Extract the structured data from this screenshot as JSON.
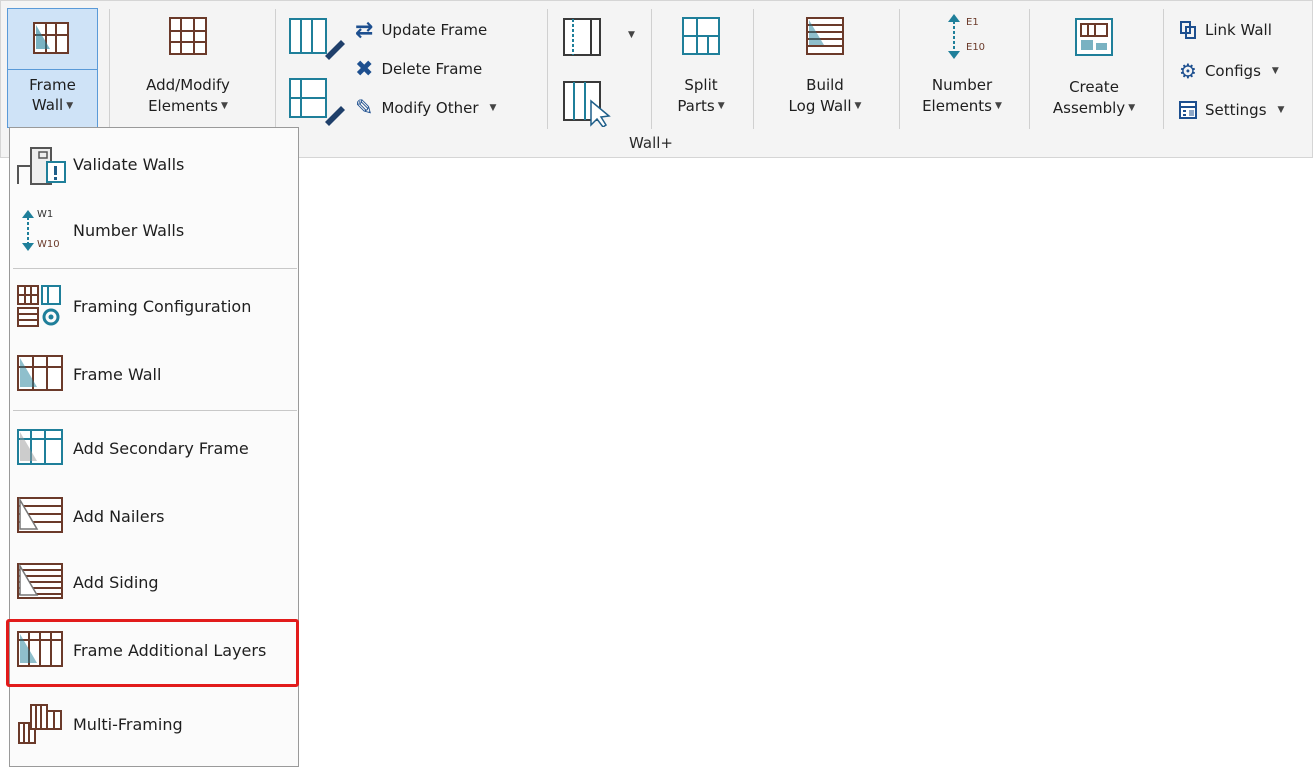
{
  "ribbon": {
    "group_label": "Wall+",
    "frame_wall": {
      "line1": "Frame",
      "line2": "Wall"
    },
    "add_modify": {
      "line1": "Add/Modify",
      "line2": "Elements"
    },
    "update_frame": "Update Frame",
    "delete_frame": "Delete Frame",
    "modify_other": "Modify Other",
    "split_parts": {
      "line1": "Split",
      "line2": "Parts"
    },
    "build_log_wall": {
      "line1": "Build",
      "line2": "Log Wall"
    },
    "number_elements": {
      "line1": "Number",
      "line2": "Elements",
      "top_tag": "E1",
      "bottom_tag": "E10"
    },
    "create_assembly": {
      "line1": "Create",
      "line2": "Assembly"
    },
    "link_wall": "Link Wall",
    "configs": "Configs",
    "settings": "Settings"
  },
  "menu": {
    "items": [
      {
        "label": "Validate Walls",
        "icon": "validate-walls-icon"
      },
      {
        "label": "Number Walls",
        "icon": "number-walls-icon",
        "top_tag": "W1",
        "bottom_tag": "W10"
      },
      {
        "label": "Framing Configuration",
        "icon": "framing-configuration-icon"
      },
      {
        "label": "Frame Wall",
        "icon": "frame-wall-icon"
      },
      {
        "label": "Add Secondary Frame",
        "icon": "secondary-frame-icon"
      },
      {
        "label": "Add Nailers",
        "icon": "nailers-icon"
      },
      {
        "label": "Add Siding",
        "icon": "siding-icon"
      },
      {
        "label": "Frame Additional Layers",
        "icon": "additional-layers-icon"
      },
      {
        "label": "Multi-Framing",
        "icon": "multi-framing-icon"
      }
    ],
    "highlighted_item": "Frame Additional Layers"
  },
  "colors": {
    "accent_brown": "#8a3b24",
    "accent_teal": "#1f7f9a",
    "selected_bg": "#cfe3f7",
    "highlight_red": "#e21b1b"
  }
}
